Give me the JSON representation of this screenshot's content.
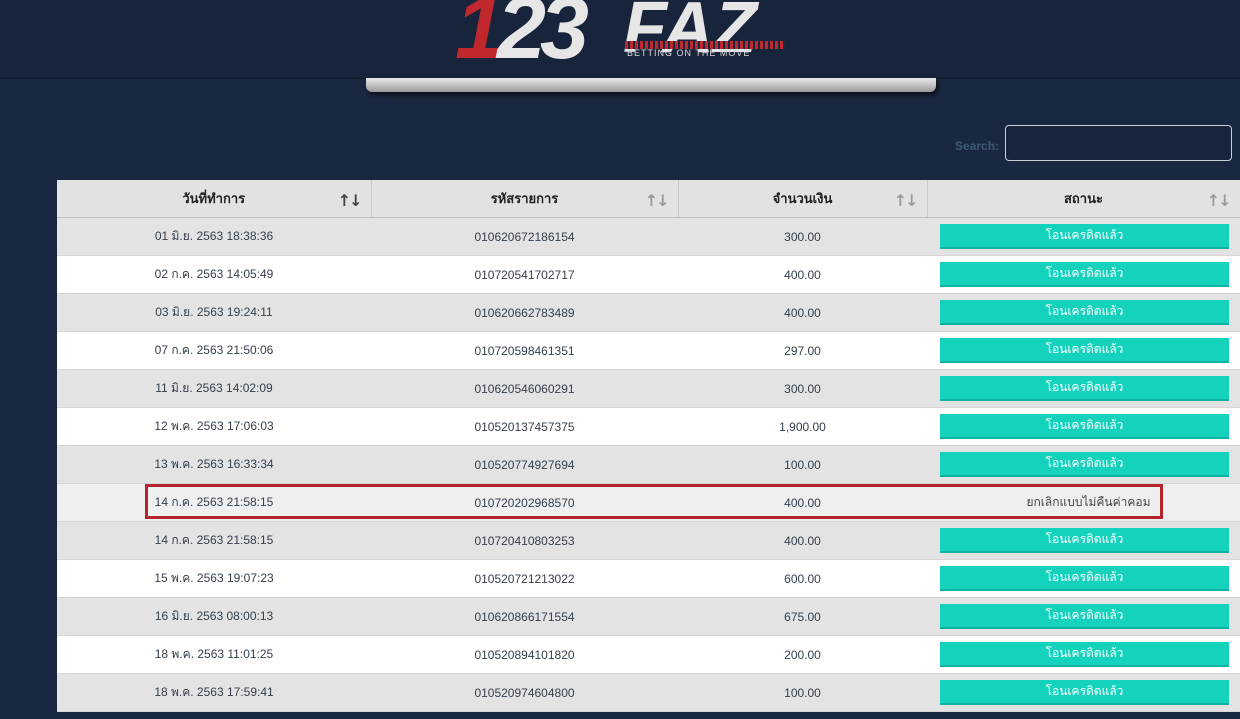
{
  "brand": {
    "logo_numbers": "123",
    "logo_letters": "FAZ",
    "tagline": "BETTING ON THE MOVE"
  },
  "search": {
    "label": "Search:",
    "value": ""
  },
  "table": {
    "columns": [
      {
        "label": "วันที่ทำการ",
        "sorted": true
      },
      {
        "label": "รหัสรายการ",
        "sorted": false
      },
      {
        "label": "จำนวนเงิน",
        "sorted": false
      },
      {
        "label": "สถานะ",
        "sorted": false
      }
    ],
    "sort_icon": "↑↓",
    "rows": [
      {
        "date": "01 มิ.ย. 2563 18:38:36",
        "id": "010620672186154",
        "amount": "300.00",
        "status": "โอนเครดิตแล้ว",
        "status_type": "button"
      },
      {
        "date": "02 ก.ค. 2563 14:05:49",
        "id": "010720541702717",
        "amount": "400.00",
        "status": "โอนเครดิตแล้ว",
        "status_type": "button"
      },
      {
        "date": "03 มิ.ย. 2563 19:24:11",
        "id": "010620662783489",
        "amount": "400.00",
        "status": "โอนเครดิตแล้ว",
        "status_type": "button"
      },
      {
        "date": "07 ก.ค. 2563 21:50:06",
        "id": "010720598461351",
        "amount": "297.00",
        "status": "โอนเครดิตแล้ว",
        "status_type": "button"
      },
      {
        "date": "11 มิ.ย. 2563 14:02:09",
        "id": "010620546060291",
        "amount": "300.00",
        "status": "โอนเครดิตแล้ว",
        "status_type": "button"
      },
      {
        "date": "12 พ.ค. 2563 17:06:03",
        "id": "010520137457375",
        "amount": "1,900.00",
        "status": "โอนเครดิตแล้ว",
        "status_type": "button"
      },
      {
        "date": "13 พ.ค. 2563 16:33:34",
        "id": "010520774927694",
        "amount": "100.00",
        "status": "โอนเครดิตแล้ว",
        "status_type": "button"
      },
      {
        "date": "14 ก.ค. 2563 21:58:15",
        "id": "010720202968570",
        "amount": "400.00",
        "status": "ยกเลิกแบบไม่คืนค่าคอม",
        "status_type": "text"
      },
      {
        "date": "14 ก.ค. 2563 21:58:15",
        "id": "010720410803253",
        "amount": "400.00",
        "status": "โอนเครดิตแล้ว",
        "status_type": "button"
      },
      {
        "date": "15 พ.ค. 2563 19:07:23",
        "id": "010520721213022",
        "amount": "600.00",
        "status": "โอนเครดิตแล้ว",
        "status_type": "button"
      },
      {
        "date": "16 มิ.ย. 2563 08:00:13",
        "id": "010620866171554",
        "amount": "675.00",
        "status": "โอนเครดิตแล้ว",
        "status_type": "button"
      },
      {
        "date": "18 พ.ค. 2563 11:01:25",
        "id": "010520894101820",
        "amount": "200.00",
        "status": "โอนเครดิตแล้ว",
        "status_type": "button"
      },
      {
        "date": "18 พ.ค. 2563 17:59:41",
        "id": "010520974604800",
        "amount": "100.00",
        "status": "โอนเครดิตแล้ว",
        "status_type": "button"
      }
    ]
  },
  "colors": {
    "background": "#1a2740",
    "status_button": "#15d2bd",
    "highlight_border": "#b5262c"
  }
}
